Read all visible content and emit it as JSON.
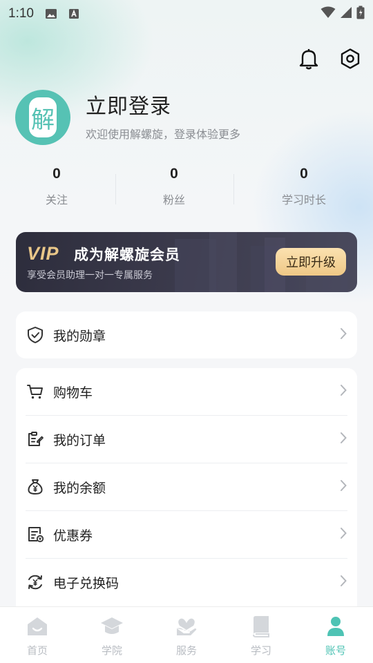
{
  "status_bar": {
    "time": "1:10"
  },
  "profile": {
    "avatar_char": "解",
    "title": "立即登录",
    "subtitle": "欢迎使用解螺旋，登录体验更多"
  },
  "stats": [
    {
      "value": "0",
      "label": "关注"
    },
    {
      "value": "0",
      "label": "粉丝"
    },
    {
      "value": "0",
      "label": "学习时长"
    }
  ],
  "vip": {
    "logo_text": "VIP",
    "title": "成为解螺旋会员",
    "subtitle": "享受会员助理一对一专属服务",
    "button": "立即升级"
  },
  "badge_card": {
    "label": "我的勋章"
  },
  "menu": [
    {
      "label": "购物车",
      "icon": "cart-icon"
    },
    {
      "label": "我的订单",
      "icon": "order-icon"
    },
    {
      "label": "我的余额",
      "icon": "wallet-icon"
    },
    {
      "label": "优惠券",
      "icon": "coupon-icon"
    },
    {
      "label": "电子兑换码",
      "icon": "exchange-icon"
    }
  ],
  "tabs": [
    {
      "label": "首页",
      "icon": "home-icon"
    },
    {
      "label": "学院",
      "icon": "graduation-cap-icon"
    },
    {
      "label": "服务",
      "icon": "heart-hand-icon"
    },
    {
      "label": "学习",
      "icon": "book-icon"
    },
    {
      "label": "账号",
      "icon": "user-icon",
      "active": true
    }
  ],
  "colors": {
    "accent": "#4ec3b4",
    "vip_gold": "#e9c789",
    "vip_bg": "#2d2d3c"
  }
}
